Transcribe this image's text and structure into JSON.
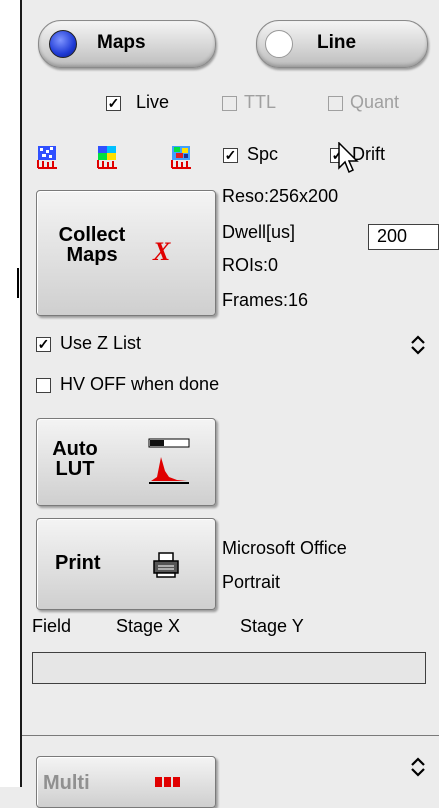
{
  "mode_buttons": {
    "maps_label": "Maps",
    "line_label": "Line"
  },
  "options": {
    "live_label": "Live",
    "ttl_label": "TTL",
    "quant_label": "Quant",
    "spc_label": "Spc",
    "drift_label": "Drift"
  },
  "collect": {
    "label_line1": "Collect",
    "label_line2": "Maps",
    "icon_letter": "X"
  },
  "info": {
    "reso": "Reso:256x200",
    "dwell_label": "Dwell[us]",
    "dwell_value": "200",
    "rois": "ROIs:0",
    "frames": "Frames:16"
  },
  "use_z_list_label": "Use Z List",
  "hv_off_label": "HV OFF when done",
  "auto_lut": {
    "label_line1": "Auto",
    "label_line2": "LUT"
  },
  "print": {
    "label": "Print",
    "printer": "Microsoft Office",
    "orientation": "Portrait"
  },
  "stage_headers": {
    "field": "Field",
    "stage_x": "Stage X",
    "stage_y": "Stage Y"
  },
  "multi": {
    "label": "Multi"
  },
  "colors": {
    "accent_blue": "#1f3bd6",
    "red": "#e00000"
  }
}
